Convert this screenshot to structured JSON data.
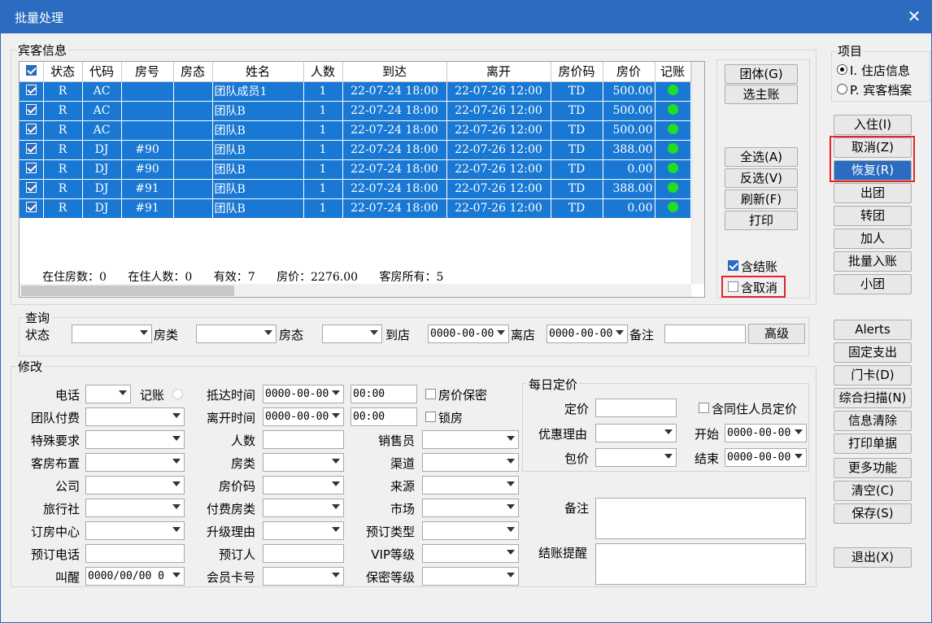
{
  "window": {
    "title": "批量处理",
    "close": "✕"
  },
  "guest_info": {
    "label": "宾客信息",
    "columns": [
      "状态",
      "代码",
      "房号",
      "房态",
      "姓名",
      "人数",
      "到达",
      "离开",
      "房价码",
      "房价",
      "记账"
    ],
    "rows": [
      {
        "status": "R",
        "code": "AC",
        "room": "",
        "room_status": "",
        "name": "团队成员1",
        "people": "1",
        "arrive": "22-07-24 18:00",
        "depart": "22-07-26 12:00",
        "rate_code": "TD",
        "rate": "500.00"
      },
      {
        "status": "R",
        "code": "AC",
        "room": "",
        "room_status": "",
        "name": "团队B",
        "people": "1",
        "arrive": "22-07-24 18:00",
        "depart": "22-07-26 12:00",
        "rate_code": "TD",
        "rate": "500.00"
      },
      {
        "status": "R",
        "code": "AC",
        "room": "",
        "room_status": "",
        "name": "团队B",
        "people": "1",
        "arrive": "22-07-24 18:00",
        "depart": "22-07-26 12:00",
        "rate_code": "TD",
        "rate": "500.00"
      },
      {
        "status": "R",
        "code": "DJ",
        "room": "#90",
        "room_status": "",
        "name": "团队B",
        "people": "1",
        "arrive": "22-07-24 18:00",
        "depart": "22-07-26 12:00",
        "rate_code": "TD",
        "rate": "388.00"
      },
      {
        "status": "R",
        "code": "DJ",
        "room": "#90",
        "room_status": "",
        "name": "团队B",
        "people": "1",
        "arrive": "22-07-24 18:00",
        "depart": "22-07-26 12:00",
        "rate_code": "TD",
        "rate": "0.00"
      },
      {
        "status": "R",
        "code": "DJ",
        "room": "#91",
        "room_status": "",
        "name": "团队B",
        "people": "1",
        "arrive": "22-07-24 18:00",
        "depart": "22-07-26 12:00",
        "rate_code": "TD",
        "rate": "388.00"
      },
      {
        "status": "R",
        "code": "DJ",
        "room": "#91",
        "room_status": "",
        "name": "团队B",
        "people": "1",
        "arrive": "22-07-24 18:00",
        "depart": "22-07-26 12:00",
        "rate_code": "TD",
        "rate": "0.00"
      }
    ],
    "summary": {
      "in_rooms": "在住房数：0",
      "in_people": "在住人数：0",
      "valid": "有效：7",
      "price": "房价：2276.00",
      "owner": "客房所有：5"
    }
  },
  "grid_buttons": {
    "group": "团体(G)",
    "main_acct": "选主账",
    "select_all": "全选(A)",
    "invert": "反选(V)",
    "refresh": "刷新(F)",
    "print": "打印"
  },
  "checks": {
    "with_checkout": "含结账",
    "with_cancel": "含取消"
  },
  "items": {
    "label": "项目",
    "opt1": "I. 住店信息",
    "opt2": "P. 宾客档案"
  },
  "right_buttons": [
    "入住(I)",
    "取消(Z)",
    "恢复(R)",
    "出团",
    "转团",
    "加人",
    "批量入账",
    "小团"
  ],
  "right_buttons2": [
    "Alerts",
    "固定支出",
    "门卡(D)",
    "综合扫描(N)",
    "信息清除",
    "打印单据",
    "更多功能",
    "清空(C)",
    "保存(S)",
    "退出(X)"
  ],
  "query": {
    "label": "查询",
    "status": "状态",
    "room_type": "房类",
    "room_state": "房态",
    "arrive": "到店",
    "arrive_val": "0000-00-00",
    "depart": "离店",
    "depart_val": "0000-00-00",
    "remark": "备注",
    "advanced": "高级"
  },
  "modify": {
    "label": "修改",
    "col1": [
      "电话",
      "团队付费",
      "特殊要求",
      "客房布置",
      "公司",
      "旅行社",
      "订房中心",
      "预订电话",
      "叫醒"
    ],
    "record": "记账",
    "wake_val": "0000/00/00 0",
    "col2": [
      "抵达时间",
      "离开时间",
      "人数",
      "房类",
      "房价码",
      "付费房类",
      "升级理由",
      "预订人",
      "会员卡号"
    ],
    "arrive_date": "0000-00-00",
    "arrive_time": "00:00",
    "depart_date": "0000-00-00",
    "depart_time": "00:00",
    "price_secret": "房价保密",
    "lock_room": "锁房",
    "col3": [
      "销售员",
      "渠道",
      "来源",
      "市场",
      "预订类型",
      "VIP等级",
      "保密等级"
    ],
    "daily": {
      "label": "每日定价",
      "price": "定价",
      "discount": "优惠理由",
      "package": "包价",
      "same_guest": "含同住人员定价",
      "start": "开始",
      "end": "结束",
      "start_val": "0000-00-00",
      "end_val": "0000-00-00"
    },
    "remark": "备注",
    "checkout_remind": "结账提醒"
  },
  "colors": {
    "accent": "#2b6cc0",
    "row": "#1878d4",
    "dot": "#22dd22",
    "red": "#e0262b"
  }
}
